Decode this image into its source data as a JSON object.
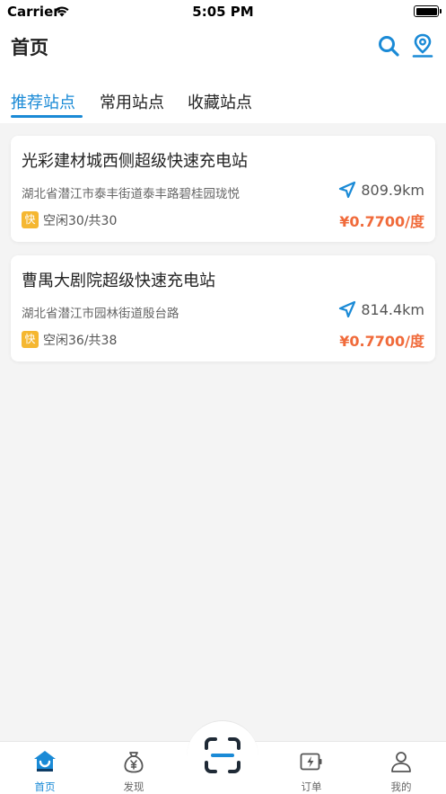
{
  "status_bar": {
    "carrier": "Carrier",
    "time": "5:05 PM"
  },
  "header": {
    "title": "首页"
  },
  "tabs": [
    {
      "label": "推荐站点",
      "active": true
    },
    {
      "label": "常用站点",
      "active": false
    },
    {
      "label": "收藏站点",
      "active": false
    }
  ],
  "stations": [
    {
      "name": "光彩建材城西侧超级快速充电站",
      "address": "湖北省潜江市泰丰街道泰丰路碧桂园珑悦",
      "distance": "809.9km",
      "badge": "快",
      "availability": "空闲30/共30",
      "price": "¥0.7700/度"
    },
    {
      "name": "曹禺大剧院超级快速充电站",
      "address": "湖北省潜江市园林街道殷台路",
      "distance": "814.4km",
      "badge": "快",
      "availability": "空闲36/共38",
      "price": "¥0.7700/度"
    }
  ],
  "tab_bar": {
    "items": [
      {
        "label": "首页",
        "icon": "home-icon",
        "active": true
      },
      {
        "label": "发现",
        "icon": "money-bag-icon",
        "active": false
      },
      {
        "label": "订单",
        "icon": "charging-battery-icon",
        "active": false
      },
      {
        "label": "我的",
        "icon": "user-icon",
        "active": false
      }
    ],
    "center_icon": "scan-icon"
  },
  "colors": {
    "accent": "#1a8ad6",
    "price": "#f06a3a",
    "badge": "#f5b731",
    "background": "#f4f4f4"
  }
}
